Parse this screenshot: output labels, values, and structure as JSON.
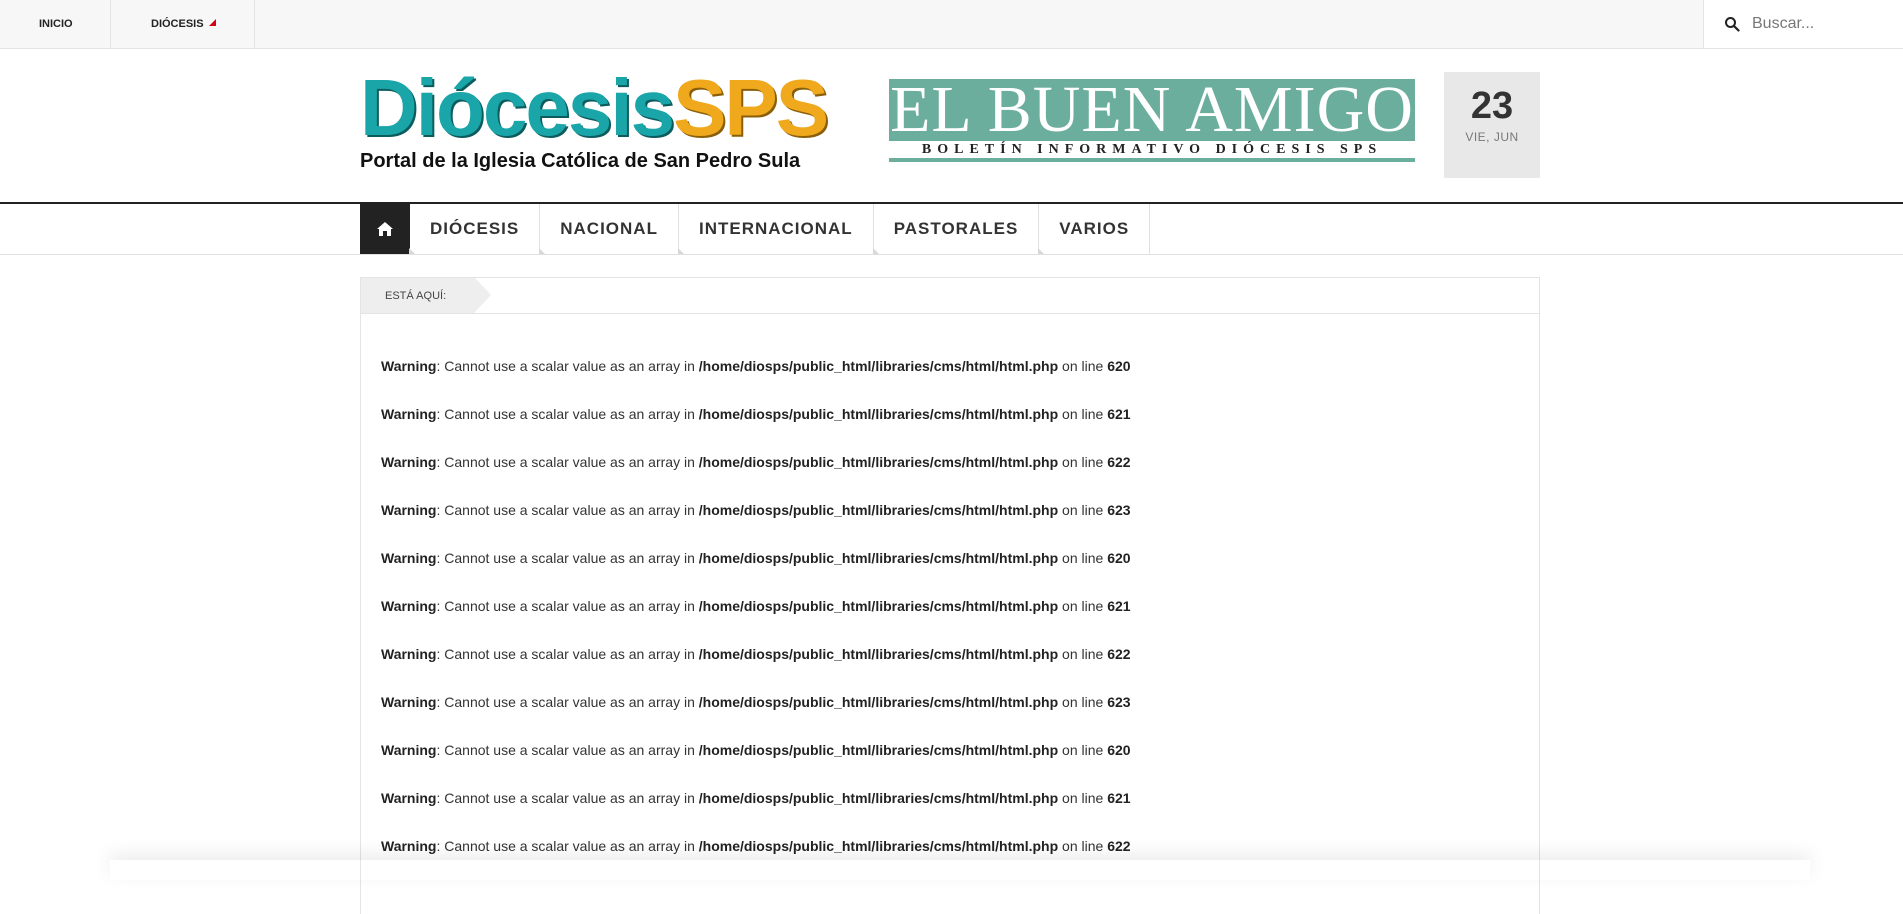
{
  "topbar": {
    "nav": [
      {
        "label": "INICIO"
      },
      {
        "label": "DIÓCESIS"
      }
    ],
    "search": {
      "placeholder": "Buscar...",
      "icon": "search-icon"
    }
  },
  "header": {
    "logo": {
      "word1": "Diócesis",
      "word2": "SPS",
      "tagline": "Portal de la Iglesia Católica de San Pedro Sula",
      "colors": {
        "teal": "#1aa5a8",
        "gold": "#f0a81c"
      }
    },
    "banner": {
      "title": "EL BUEN AMIGO",
      "subtitle": "BOLETÍN INFORMATIVO DIÓCESIS SPS",
      "color": "#6cae9d"
    },
    "date": {
      "day": "23",
      "weekday_month": "VIE, JUN"
    }
  },
  "mainnav": {
    "home_icon": "home-icon",
    "items": [
      {
        "label": "DIÓCESIS"
      },
      {
        "label": "NACIONAL"
      },
      {
        "label": "INTERNACIONAL"
      },
      {
        "label": "PASTORALES"
      },
      {
        "label": "VARIOS"
      }
    ]
  },
  "breadcrumb": {
    "label": "ESTÁ AQUÍ:"
  },
  "warnings": [
    {
      "type": "Warning",
      "message": ": Cannot use a scalar value as an array in ",
      "path": "/home/diosps/public_html/libraries/cms/html/html.php",
      "online": " on line ",
      "line": "620"
    },
    {
      "type": "Warning",
      "message": ": Cannot use a scalar value as an array in ",
      "path": "/home/diosps/public_html/libraries/cms/html/html.php",
      "online": " on line ",
      "line": "621"
    },
    {
      "type": "Warning",
      "message": ": Cannot use a scalar value as an array in ",
      "path": "/home/diosps/public_html/libraries/cms/html/html.php",
      "online": " on line ",
      "line": "622"
    },
    {
      "type": "Warning",
      "message": ": Cannot use a scalar value as an array in ",
      "path": "/home/diosps/public_html/libraries/cms/html/html.php",
      "online": " on line ",
      "line": "623"
    },
    {
      "type": "Warning",
      "message": ": Cannot use a scalar value as an array in ",
      "path": "/home/diosps/public_html/libraries/cms/html/html.php",
      "online": " on line ",
      "line": "620"
    },
    {
      "type": "Warning",
      "message": ": Cannot use a scalar value as an array in ",
      "path": "/home/diosps/public_html/libraries/cms/html/html.php",
      "online": " on line ",
      "line": "621"
    },
    {
      "type": "Warning",
      "message": ": Cannot use a scalar value as an array in ",
      "path": "/home/diosps/public_html/libraries/cms/html/html.php",
      "online": " on line ",
      "line": "622"
    },
    {
      "type": "Warning",
      "message": ": Cannot use a scalar value as an array in ",
      "path": "/home/diosps/public_html/libraries/cms/html/html.php",
      "online": " on line ",
      "line": "623"
    },
    {
      "type": "Warning",
      "message": ": Cannot use a scalar value as an array in ",
      "path": "/home/diosps/public_html/libraries/cms/html/html.php",
      "online": " on line ",
      "line": "620"
    },
    {
      "type": "Warning",
      "message": ": Cannot use a scalar value as an array in ",
      "path": "/home/diosps/public_html/libraries/cms/html/html.php",
      "online": " on line ",
      "line": "621"
    },
    {
      "type": "Warning",
      "message": ": Cannot use a scalar value as an array in ",
      "path": "/home/diosps/public_html/libraries/cms/html/html.php",
      "online": " on line ",
      "line": "622"
    }
  ]
}
